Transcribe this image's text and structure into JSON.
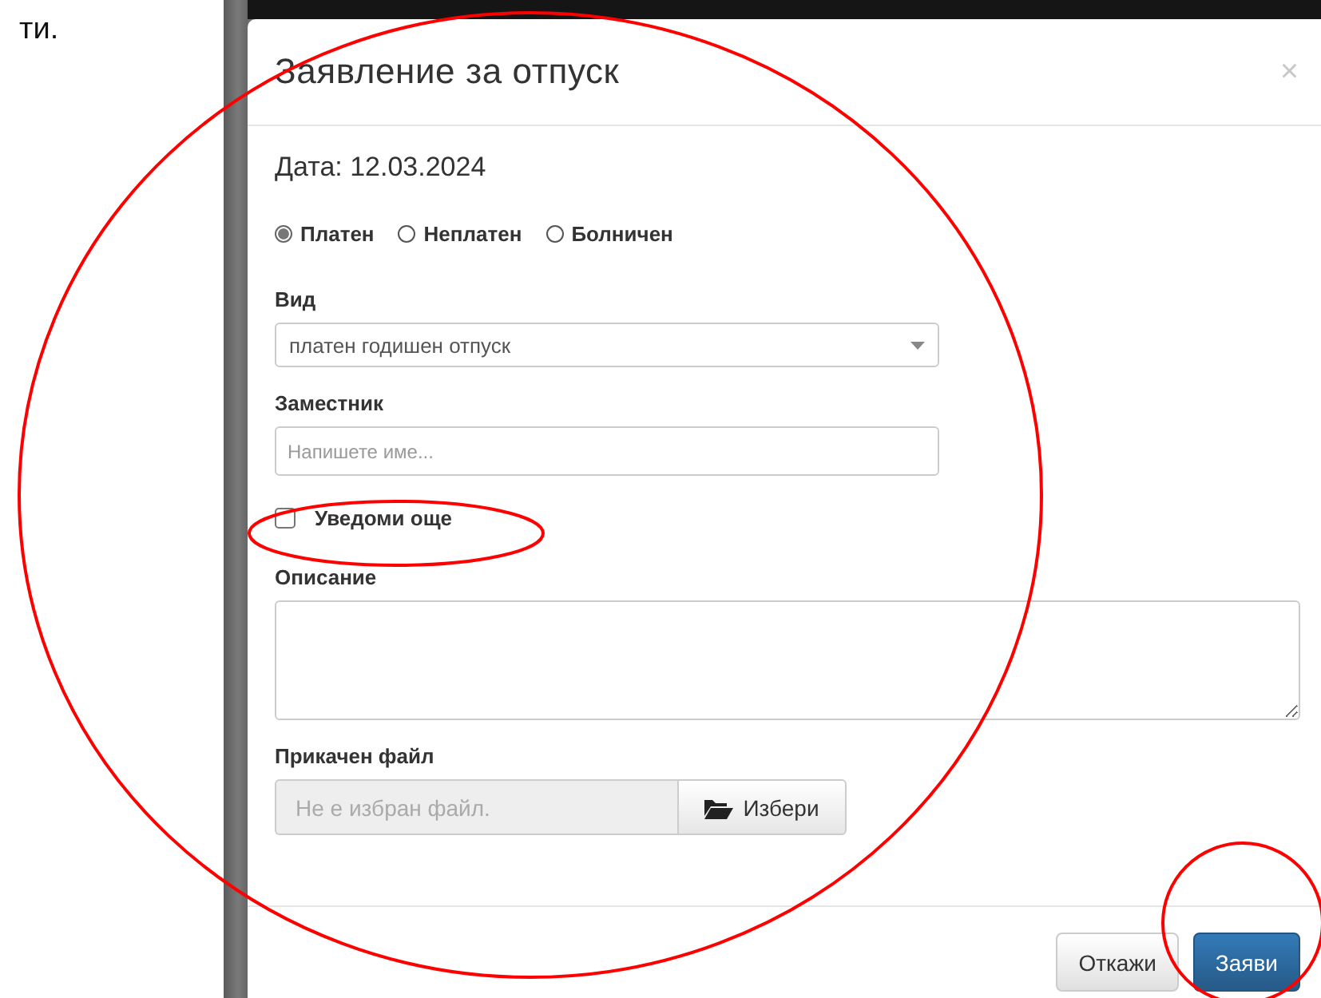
{
  "page": {
    "text": "ти."
  },
  "modal": {
    "title": "Заявление за отпуск",
    "close": "×"
  },
  "date": "Дата: 12.03.2024",
  "leave_types": [
    {
      "label": "Платен",
      "selected": true
    },
    {
      "label": "Неплатен",
      "selected": false
    },
    {
      "label": "Болничен",
      "selected": false
    }
  ],
  "type_field": {
    "label": "Вид",
    "value": "платен годишен отпуск"
  },
  "deputy_field": {
    "label": "Заместник",
    "placeholder": "Напишете име..."
  },
  "notify": {
    "label": "Уведоми още",
    "checked": false
  },
  "description": {
    "label": "Описание"
  },
  "attachment": {
    "label": "Прикачен файл",
    "placeholder": "Не е избран файл.",
    "button": "Избери"
  },
  "buttons": [
    {
      "label": "Откажи",
      "kind": "default"
    },
    {
      "label": "Заяви",
      "kind": "primary"
    }
  ]
}
